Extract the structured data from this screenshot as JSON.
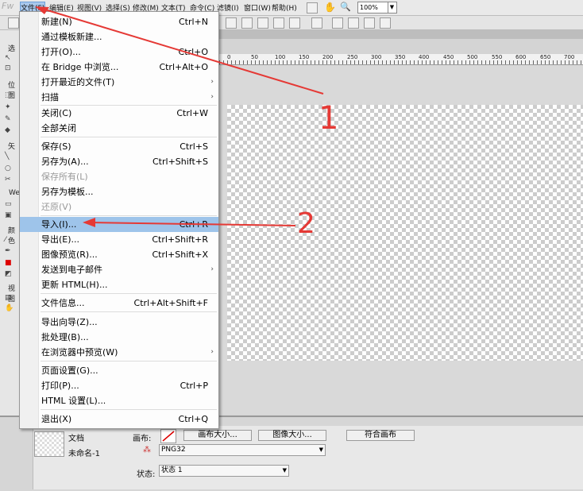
{
  "app": {
    "logo": "Fw"
  },
  "menubar": {
    "items": [
      "文件(F)",
      "编辑(E)",
      "视图(V)",
      "选择(S)",
      "修改(M)",
      "文本(T)",
      "命令(C)",
      "滤镜(I)",
      "窗口(W)",
      "帮助(H)"
    ],
    "zoom": "100%"
  },
  "file_menu": {
    "items": [
      {
        "label": "新建(N)",
        "shortcut": "Ctrl+N"
      },
      {
        "label": "通过模板新建...",
        "shortcut": ""
      },
      {
        "label": "打开(O)...",
        "shortcut": "Ctrl+O"
      },
      {
        "label": "在 Bridge 中浏览...",
        "shortcut": "Ctrl+Alt+O"
      },
      {
        "label": "打开最近的文件(T)",
        "shortcut": "",
        "submenu": true
      },
      {
        "label": "扫描",
        "shortcut": "",
        "submenu": true
      },
      {
        "label": "关闭(C)",
        "shortcut": "Ctrl+W"
      },
      {
        "label": "全部关闭",
        "shortcut": ""
      },
      {
        "label": "保存(S)",
        "shortcut": "Ctrl+S"
      },
      {
        "label": "另存为(A)...",
        "shortcut": "Ctrl+Shift+S"
      },
      {
        "label": "保存所有(L)",
        "shortcut": "",
        "disabled": true
      },
      {
        "label": "另存为模板...",
        "shortcut": ""
      },
      {
        "label": "还原(V)",
        "shortcut": "",
        "disabled": true
      },
      {
        "label": "导入(I)...",
        "shortcut": "Ctrl+R",
        "highlighted": true
      },
      {
        "label": "导出(E)...",
        "shortcut": "Ctrl+Shift+R"
      },
      {
        "label": "图像预览(R)...",
        "shortcut": "Ctrl+Shift+X"
      },
      {
        "label": "发送到电子邮件",
        "shortcut": "",
        "submenu": true
      },
      {
        "label": "更新 HTML(H)...",
        "shortcut": ""
      },
      {
        "label": "文件信息...",
        "shortcut": "Ctrl+Alt+Shift+F"
      },
      {
        "label": "导出向导(Z)...",
        "shortcut": ""
      },
      {
        "label": "批处理(B)...",
        "shortcut": ""
      },
      {
        "label": "在浏览器中预览(W)",
        "shortcut": "",
        "submenu": true
      },
      {
        "label": "页面设置(G)...",
        "shortcut": ""
      },
      {
        "label": "打印(P)...",
        "shortcut": "Ctrl+P"
      },
      {
        "label": "HTML 设置(L)...",
        "shortcut": ""
      },
      {
        "label": "退出(X)",
        "shortcut": "Ctrl+Q"
      }
    ]
  },
  "tool_panel": {
    "labels": [
      "选",
      "位图",
      "矢",
      "Web",
      "颜色",
      "视图"
    ]
  },
  "ruler": {
    "ticks": [
      "0",
      "50",
      "100",
      "150",
      "200",
      "250",
      "300",
      "350",
      "400",
      "450",
      "500",
      "550",
      "600",
      "650",
      "700"
    ]
  },
  "properties": {
    "doc_label": "文档",
    "doc_name": "未命名-1",
    "canvas_label": "画布:",
    "canvas_size_btn": "画布大小...",
    "image_size_btn": "图像大小...",
    "fit_canvas_btn": "符合画布",
    "format": "PNG32",
    "state_label": "状态:",
    "state_value": "状态 1"
  },
  "annotations": {
    "mark1": "1",
    "mark2": "2",
    "color": "#e53935"
  }
}
